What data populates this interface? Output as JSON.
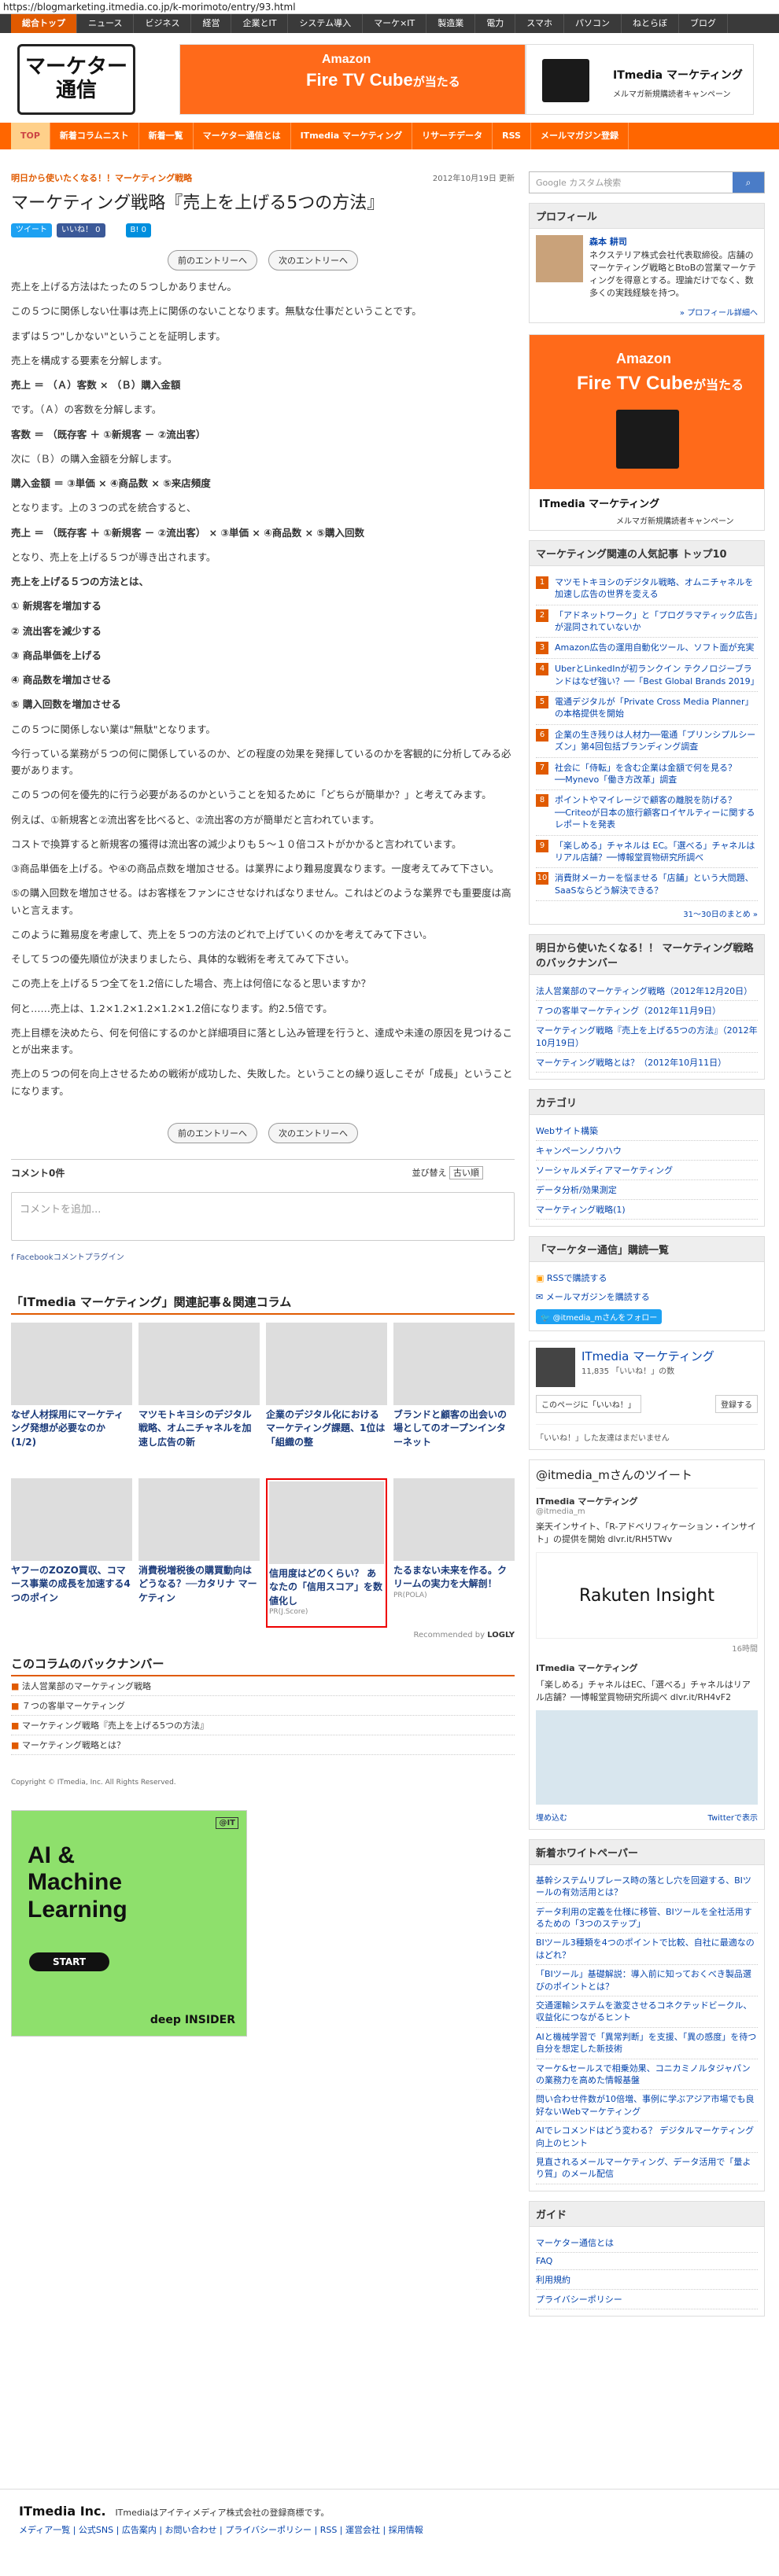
{
  "browser": {
    "url": "https://blogmarketing.itmedia.co.jp/k-morimoto/entry/93.html"
  },
  "topnav": [
    "総合トップ",
    "ニュース",
    "ビジネス",
    "経営",
    "企業とIT",
    "システム導入",
    "マーケ×IT",
    "製造業",
    "電力",
    "スマホ",
    "パソコン",
    "ねとらぼ",
    "ブログ"
  ],
  "logo": {
    "line1": "マーケター",
    "line2": "通信"
  },
  "banner": {
    "brand": "Amazon",
    "product": "Fire TV Cube",
    "suffix": "が当たる",
    "campaign_brand": "ITmedia マーケティング",
    "campaign_text": "メルマガ新規購読者キャンペーン"
  },
  "orangenav": [
    "TOP",
    "新着コラムニスト",
    "新着一覧",
    "マーケター通信とは",
    "ITmedia マーケティング",
    "リサーチデータ",
    "RSS",
    "メールマガジン登録"
  ],
  "article": {
    "category": "明日から使いたくなる！！マーケティング戦略",
    "date": "2012年10月19日 更新",
    "title": "マーケティング戦略『売上を上げる5つの方法』",
    "tweet": "ツイート",
    "like": "いいね！ 0",
    "hatena": "B! 0",
    "prev": "前のエントリーへ",
    "next": "次のエントリーへ",
    "paragraphs": [
      {
        "t": "売上を上げる方法はたったの５つしかありません。",
        "b": false
      },
      {
        "t": "この５つに関係しない仕事は売上に関係のないことなります。無駄な仕事だということです。",
        "b": false
      },
      {
        "t": "まずは５つ\"しかない\"ということを証明します。",
        "b": false
      },
      {
        "t": "売上を構成する要素を分解します。",
        "b": false
      },
      {
        "t": "売上 ＝ （Ａ）客数 × （Ｂ）購入金額",
        "b": true
      },
      {
        "t": "です。（Ａ）の客数を分解します。",
        "b": false
      },
      {
        "t": "客数 ＝ （既存客 ＋ ①新規客 － ②流出客）",
        "b": true
      },
      {
        "t": "次に（Ｂ）の購入金額を分解します。",
        "b": false
      },
      {
        "t": "購入金額 ＝ ③単価 × ④商品数 × ⑤来店頻度",
        "b": true
      },
      {
        "t": "となります。上の３つの式を統合すると、",
        "b": false
      },
      {
        "t": "売上 ＝ （既存客 ＋ ①新規客 － ②流出客） × ③単価 × ④商品数 × ⑤購入回数",
        "b": true
      },
      {
        "t": "となり、売上を上げる５つが導き出されます。",
        "b": false
      },
      {
        "t": "売上を上げる５つの方法とは、",
        "b": true
      },
      {
        "t": "① 新規客を増加する",
        "b": true
      },
      {
        "t": "② 流出客を減少する",
        "b": true
      },
      {
        "t": "③ 商品単価を上げる",
        "b": true
      },
      {
        "t": "④ 商品数を増加させる",
        "b": true
      },
      {
        "t": "⑤ 購入回数を増加させる",
        "b": true
      },
      {
        "t": "この５つに関係しない業は\"無駄\"となります。",
        "b": false
      },
      {
        "t": "今行っている業務が５つの何に関係しているのか、どの程度の効果を発揮しているのかを客観的に分析してみる必要があります。",
        "b": false
      },
      {
        "t": "この５つの何を優先的に行う必要があるのかということを知るために「どちらが簡単か？」と考えてみます。",
        "b": false
      },
      {
        "t": "例えば、①新規客と②流出客を比べると、②流出客の方が簡単だと言われています。",
        "b": false
      },
      {
        "t": "コストで換算すると新規客の獲得は流出客の減少よりも５～１０倍コストがかかると言われています。",
        "b": false
      },
      {
        "t": "③商品単価を上げる。や④の商品点数を増加させる。は業界により難易度異なります。一度考えてみて下さい。",
        "b": false
      },
      {
        "t": "⑤の購入回数を増加させる。はお客様をファンにさせなければなりません。これはどのような業界でも重要度は高いと言えます。",
        "b": false
      },
      {
        "t": "このように難易度を考慮して、売上を５つの方法のどれで上げていくのかを考えてみて下さい。",
        "b": false
      },
      {
        "t": "そして５つの優先順位が決まりましたら、具体的な戦術を考えてみて下さい。",
        "b": false
      },
      {
        "t": "この売上を上げる５つ全てを1.2倍にした場合、売上は何倍になると思いますか？",
        "b": false
      },
      {
        "t": "何と……売上は、1.2×1.2×1.2×1.2×1.2倍になります。約2.5倍です。",
        "b": false
      },
      {
        "t": "売上目標を決めたら、何を何倍にするのかと詳細項目に落とし込み管理を行うと、達成や未達の原因を見つけることが出来ます。",
        "b": false
      },
      {
        "t": "売上の５つの何を向上させるための戦術が成功した、失敗した。ということの繰り返しこそが「成長」ということになります。",
        "b": false
      }
    ]
  },
  "comments": {
    "count": "コメント0件",
    "sort_label": "並び替え",
    "sort_value": "古い順",
    "placeholder": "コメントを追加...",
    "plugin": "Facebookコメントプラグイン"
  },
  "related": {
    "title": "「ITmedia マーケティング」関連記事＆関連コラム",
    "cards": [
      {
        "t": "なぜ人材採用にマーケティング発想が必要なのか (1/2)",
        "pr": ""
      },
      {
        "t": "マツモトキヨシのデジタル戦略、オムニチャネルを加速し広告の新",
        "pr": ""
      },
      {
        "t": "企業のデジタル化におけるマーケティング課題、1位は「組織の整",
        "pr": ""
      },
      {
        "t": "ブランドと顧客の出会いの場としてのオープンインターネット",
        "pr": ""
      },
      {
        "t": "ヤフーのZOZO買収、コマース事業の成長を加速する4つのポイン",
        "pr": ""
      },
      {
        "t": "消費税増税後の購買動向はどうなる？──カタリナ マーケティン",
        "pr": ""
      },
      {
        "t": "信用度はどのくらい？ あなたの「信用スコア」を数値化し",
        "pr": "PR(J.Score)"
      },
      {
        "t": "たるまない未来を作る。クリームの実力を大解剖！",
        "pr": "PR(POLA)"
      }
    ],
    "recommended": "Recommended by",
    "logly": "LOGLY"
  },
  "backnumber": {
    "title": "このコラムのバックナンバー",
    "items": [
      "法人営業部のマーケティング戦略",
      "７つの客単マーケティング",
      "マーケティング戦略『売上を上げる5つの方法』",
      "マーケティング戦略とは？"
    ]
  },
  "copyright": "Copyright © ITmedia, Inc. All Rights Reserved.",
  "ad": {
    "line1": "AI &",
    "line2": "Machine",
    "line3": "Learning",
    "cta": "START",
    "brand": "deep INSIDER",
    "tag": "@IT"
  },
  "sidebar": {
    "search_placeholder": "Google カスタム検索",
    "profile": {
      "h": "プロフィール",
      "name": "森本 耕司",
      "desc": "ネクステリア株式会社代表取締役。店舗のマーケティング戦略とBtoBの営業マーケティングを得意とする。理論だけでなく、数多くの実践経験を持つ。",
      "more": "» プロフィール詳細へ"
    },
    "ranking": {
      "h": "マーケティング関連の人気記事 トップ10",
      "items": [
        "マツモトキヨシのデジタル戦略、オムニチャネルを加速し広告の世界を変える",
        "「アドネットワーク」と「プログラマティック広告」が混同されていないか",
        "Amazon広告の運用自動化ツール、ソフト面が充実",
        "UberとLinkedInが初ランクイン テクノロジーブランドはなぜ強い？──「Best Global Brands 2019」",
        "電通デジタルが「Private Cross Media Planner」の本格提供を開始",
        "企業の生き残りは人材力──電通「プリンシプルシーズン」第4回包括ブランディング調査",
        "社会に「侍転」を含む企業は金額で何を見る？──Mynevo「働き方改革」調査",
        "ポイントやマイレージで顧客の離脱を防げる？──Criteoが日本の旅行顧客ロイヤルティーに関するレポートを発表",
        "「楽しめる」チャネルは EC。「選べる」チャネルはリアル店舗？──博報堂買物研究所調べ",
        "消費財メーカーを悩ませる「店舗」という大問題、SaaSならどう解決できる？"
      ],
      "more": "31〜30日のまとめ »"
    },
    "newentries": {
      "h": "明日から使いたくなる！！ マーケティング戦略のバックナンバー",
      "items": [
        "法人営業部のマーケティング戦略（2012年12月20日）",
        "７つの客単マーケティング（2012年11月9日）",
        "マーケティング戦略『売上を上げる5つの方法』（2012年10月19日）",
        "マーケティング戦略とは？（2012年10月11日）"
      ]
    },
    "categories": {
      "h": "カテゴリ",
      "items": [
        "Webサイト構築",
        "キャンペーンノウハウ",
        "ソーシャルメディアマーケティング",
        "データ分析/効果測定",
        "マーケティング戦略(1)"
      ]
    },
    "subscribe": {
      "h": "「マーケター通信」購読一覧",
      "rss": "RSSで購読する",
      "mail": "メールマガジンを購読する",
      "follow": "@itmedia_mさんをフォロー"
    },
    "fb": {
      "name": "ITmedia マーケティング",
      "likes": "11,835 「いいね！」の数",
      "like_btn": "このページに「いいね！」",
      "reg": "登録する",
      "friends": "「いいね！」した友達はまだいません"
    },
    "twitter": {
      "h": "@itmedia_mさんのツイート",
      "name": "ITmedia マーケティング",
      "handle": "@itmedia_m",
      "tweet1": "楽天インサイト、「R-アドベリフィケーション・インサイト」の提供を開始 dlvr.it/RH5TWv",
      "brand": "Rakuten Insight",
      "time": "16時間",
      "tweet2": "「楽しめる」チャネルはEC、「選べる」チャネルはリアル店舗？──博報堂買物研究所調べ dlvr.it/RH4vF2",
      "embed": "埋め込む",
      "view": "Twitterで表示"
    },
    "whitepaper": {
      "h": "新着ホワイトペーパー",
      "items": [
        "基幹システムリプレース時の落とし穴を回避する、BIツールの有効活用とは？",
        "データ利用の定義を仕様に移管、BIツールを全社活用するための「3つのステップ」",
        "BIツール3種類を4つのポイントで比較、自社に最適なのはどれ？",
        "「BIツール」基礎解説：導入前に知っておくべき製品選びのポイントとは？",
        "交通運輸システムを激変させるコネクテッドビークル、収益化につながるヒント",
        "AIと機械学習で「異常判断」を支援、「異の感度」を待つ自分を想定した新技術",
        "マーケ&セールスで相乗効果、コニカミノルタジャパンの業務力を高めた情報基盤",
        "問い合わせ件数が10倍増、事例に学ぶアジア市場でも良好ないWebマーケティング",
        "AIでレコメンドはどう変わる？ デジタルマーケティング向上のヒント",
        "見直されるメールマーケティング、データ活用で「量より質」のメール配信"
      ]
    },
    "guide": {
      "h": "ガイド",
      "items": [
        "マーケター通信とは",
        "FAQ",
        "利用規約",
        "プライバシーポリシー"
      ]
    }
  },
  "footer": {
    "logo": "ITmedia Inc.",
    "note": "ITmediaはアイティメディア株式会社の登録商標です。",
    "links": "メディア一覧 | 公式SNS | 広告案内 | お問い合わせ | プライバシーポリシー | RSS | 運営会社 | 採用情報"
  }
}
